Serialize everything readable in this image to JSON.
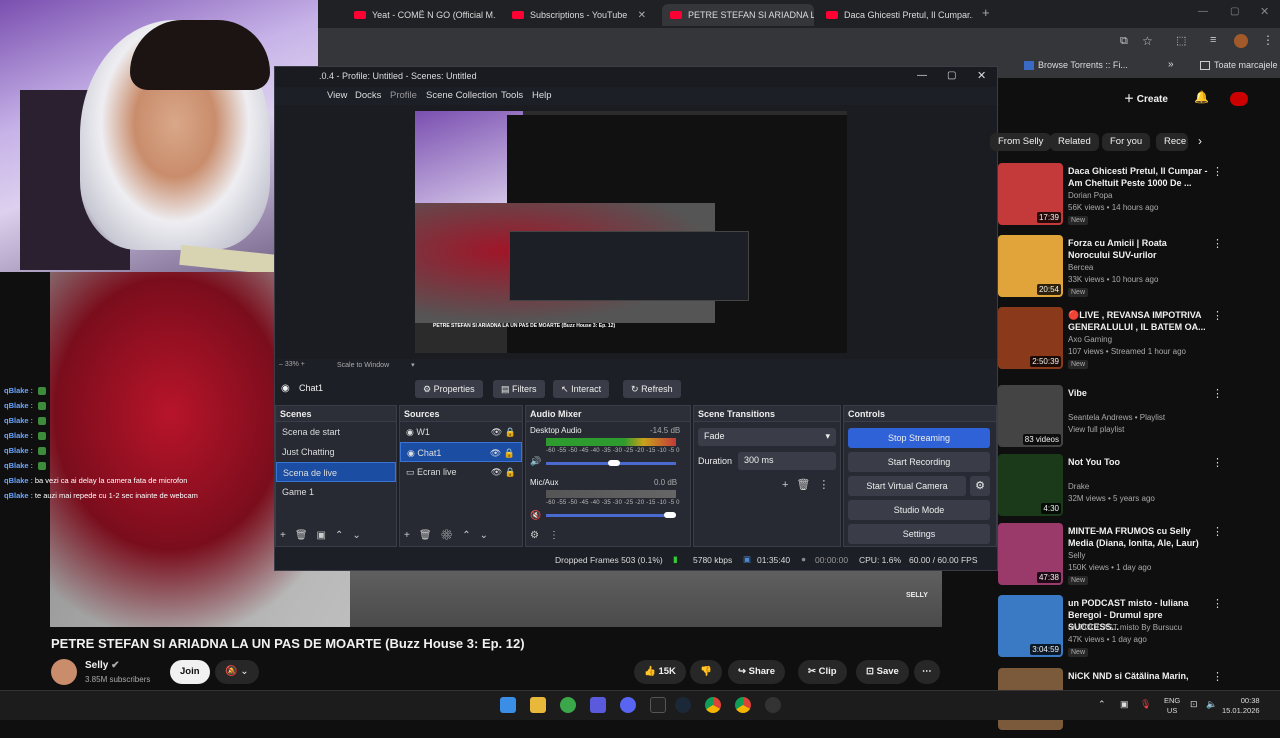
{
  "browser": {
    "tabs": [
      {
        "title": "Yeat - COMË N GO (Official M...",
        "active": false
      },
      {
        "title": "Subscriptions - YouTube",
        "active": false
      },
      {
        "title": "PETRE STEFAN SI ARIADNA LA U...",
        "active": true
      },
      {
        "title": "Daca Ghicesti Pretul, Il Cumpar...",
        "active": false
      }
    ],
    "bookmarks": [
      "Browse Torrents :: Fi...",
      "Toate marcajele"
    ]
  },
  "obs": {
    "title": ".0.4 - Profile: Untitled - Scenes: Untitled",
    "menu": [
      "View",
      "Docks",
      "Profile",
      "Scene Collection",
      "Tools",
      "Help"
    ],
    "zoom": "33%",
    "scale_mode": "Scale to Window",
    "selected_source": "Chat1",
    "source_toolbar": {
      "properties": "Properties",
      "filters": "Filters",
      "interact": "Interact",
      "refresh": "Refresh"
    },
    "scenes": {
      "header": "Scenes",
      "items": [
        "Scena de start",
        "Just Chatting",
        "Scena de live",
        "Game 1"
      ],
      "selected": 2
    },
    "sources": {
      "header": "Sources",
      "items": [
        "W1",
        "Chat1",
        "Ecran live"
      ],
      "selected": 1
    },
    "mixer": {
      "header": "Audio Mixer",
      "channels": [
        {
          "name": "Desktop Audio",
          "db": "-14.5 dB",
          "level": 0.75
        },
        {
          "name": "Mic/Aux",
          "db": "0.0 dB",
          "level": 0.45
        }
      ],
      "scale": "-60 -55 -50 -45 -40 -35 -30 -25 -20 -15 -10 -5 0"
    },
    "transitions": {
      "header": "Scene Transitions",
      "type": "Fade",
      "duration_label": "Duration",
      "duration": "300 ms"
    },
    "controls": {
      "header": "Controls",
      "buttons": [
        "Stop Streaming",
        "Start Recording",
        "Start Virtual Camera",
        "Studio Mode",
        "Settings"
      ]
    },
    "status": {
      "dropped": "Dropped Frames 503 (0.1%)",
      "bitrate": "5780 kbps",
      "live_time": "01:35:40",
      "rec_time": "00:00:00",
      "cpu": "CPU: 1.6%",
      "fps": "60.00 / 60.00 FPS"
    }
  },
  "chat": [
    {
      "user": "qBlake",
      "text": ""
    },
    {
      "user": "qBlake",
      "text": ""
    },
    {
      "user": "qBlake",
      "text": ""
    },
    {
      "user": "qBlake",
      "text": ""
    },
    {
      "user": "qBlake",
      "text": ""
    },
    {
      "user": "qBlake",
      "text": ""
    },
    {
      "user": "qBlake",
      "text": "ba vezi ca ai delay la camera fata de microfon"
    },
    {
      "user": "qBlake",
      "text": "te auzi mai repede cu 1-2 sec inainte de webcam"
    }
  ],
  "youtube": {
    "create_label": "Create",
    "chips": [
      "From Selly",
      "Related",
      "For you",
      "Rece"
    ],
    "video_title": "PETRE STEFAN SI ARIADNA LA UN PAS DE MOARTE (Buzz House 3: Ep. 12)",
    "channel": "Selly",
    "subscribers": "3.85M subscribers",
    "join_label": "Join",
    "likes": "15K",
    "share_label": "Share",
    "clip_label": "Clip",
    "save_label": "Save",
    "recommendations": [
      {
        "title": "Daca Ghicesti Pretul, Il Cumpar - Am Cheltuit Peste 1000 De ...",
        "channel": "Dorian Popa",
        "meta": "56K views • 14 hours ago",
        "new": "New",
        "duration": "17:39",
        "color": "#c43a3a"
      },
      {
        "title": "Forza cu Amicii | Roata Norocului SUV-urilor",
        "channel": "Bercea",
        "meta": "33K views • 10 hours ago",
        "new": "New",
        "duration": "20:54",
        "color": "#e0a43a"
      },
      {
        "title": "🔴LIVE , REVANSA IMPOTRIVA GENERALULUI , IL BATEM OA...",
        "channel": "Axo Gaming",
        "meta": "107 views • Streamed 1 hour ago",
        "new": "New",
        "duration": "2:50:39",
        "color": "#8a3a1a"
      },
      {
        "title": "Vibe",
        "channel": "Seantela Andrews • Playlist",
        "meta": "View full playlist",
        "new": "",
        "duration": "83 videos",
        "color": "#444"
      },
      {
        "title": "Not You Too",
        "channel": "Drake",
        "meta": "32M views • 5 years ago",
        "new": "",
        "duration": "4:30",
        "color": "#1a3a1a"
      },
      {
        "title": "MINTE-MA FRUMOS cu Selly Media (Diana, Ionita, Ale, Laur)",
        "channel": "Selly",
        "meta": "150K views • 1 day ago",
        "new": "New",
        "duration": "47:38",
        "color": "#9a3a6a"
      },
      {
        "title": "un PODCAST misto - Iuliana Beregoi - Drumul spre SUCCESS...",
        "channel": "un PODCAST misto By Bursucu",
        "meta": "47K views • 1 day ago",
        "new": "New",
        "duration": "3:04:59",
        "color": "#3a7ac4"
      },
      {
        "title": "NiCK NND si Cătălina Marin,",
        "channel": "",
        "meta": "",
        "new": "",
        "duration": "",
        "color": "#7a5a3a"
      }
    ]
  },
  "taskbar": {
    "lang": "ENG",
    "region": "US",
    "time": "00:38",
    "date": "15.01.2026"
  }
}
